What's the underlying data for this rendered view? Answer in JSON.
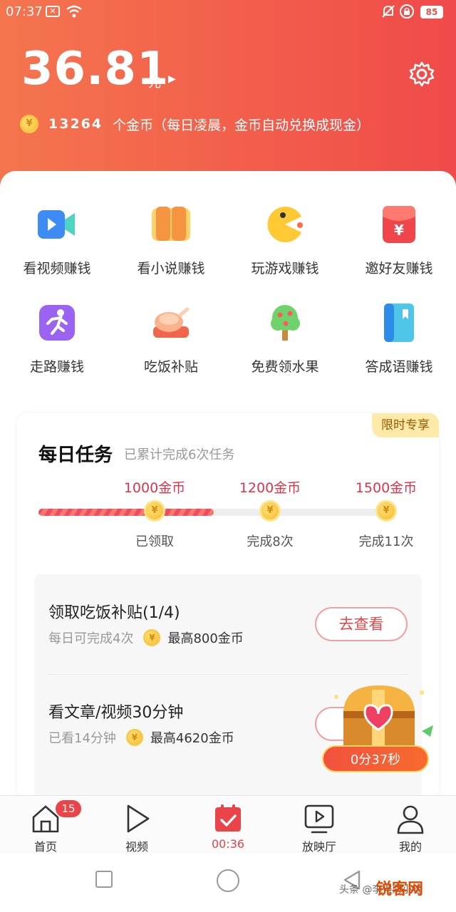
{
  "status_bar": {
    "time": "07:37",
    "battery": "85"
  },
  "wallet": {
    "balance": "36.81",
    "unit": "元",
    "coins": "13264",
    "coins_text": "个金币（每日凌晨，金币自动兑换成现金）"
  },
  "features": [
    {
      "label": "看视频赚钱",
      "icon": "video-camera-icon"
    },
    {
      "label": "看小说赚钱",
      "icon": "book-icon"
    },
    {
      "label": "玩游戏赚钱",
      "icon": "pacman-icon"
    },
    {
      "label": "邀好友赚钱",
      "icon": "red-envelope-icon"
    },
    {
      "label": "走路赚钱",
      "icon": "running-icon"
    },
    {
      "label": "吃饭补贴",
      "icon": "roast-chicken-icon"
    },
    {
      "label": "免费领水果",
      "icon": "fruit-tree-icon"
    },
    {
      "label": "答成语赚钱",
      "icon": "dictionary-icon"
    }
  ],
  "daily_tasks": {
    "badge": "限时专享",
    "title": "每日任务",
    "subtitle": "已累计完成6次任务",
    "progress_fraction": 0.5,
    "milestones": [
      {
        "reward": "1000金币",
        "status": "已领取"
      },
      {
        "reward": "1200金币",
        "status": "完成8次"
      },
      {
        "reward": "1500金币",
        "status": "完成11次"
      }
    ],
    "tasks": [
      {
        "name": "领取吃饭补贴(1/4)",
        "desc": "每日可完成4次",
        "max": "最高800金币",
        "button": "去查看"
      },
      {
        "name": "看文章/视频30分钟",
        "desc": "已看14分钟",
        "max": "最高4620金币",
        "button": "去"
      }
    ],
    "chest_timer": "0分37秒"
  },
  "tab_bar": [
    {
      "label": "首页",
      "icon": "home-icon",
      "badge": "15"
    },
    {
      "label": "视频",
      "icon": "play-icon"
    },
    {
      "label": "00:36",
      "icon": "calendar-check-icon"
    },
    {
      "label": "放映厅",
      "icon": "tv-icon"
    },
    {
      "label": "我的",
      "icon": "profile-icon"
    }
  ],
  "watermark": {
    "text": "头条 @李得财小艳",
    "brand": "锐客网"
  },
  "colors": {
    "accent": "#f25e4b",
    "tab_active": "#e6414a",
    "coin": "#f5b82a"
  }
}
